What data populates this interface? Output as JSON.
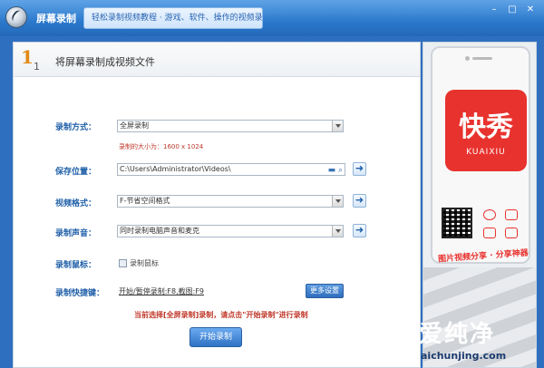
{
  "titlebar": {
    "app_title": "屏幕录制",
    "active_tab": "轻松录制视频教程 · 游戏、软件、操作的视频录制工具",
    "min_glyph": "–",
    "max_glyph": "□",
    "close_glyph": "✕"
  },
  "step": {
    "number": "1",
    "sub": "1",
    "title": "将屏幕录制成视频文件"
  },
  "form": {
    "record_mode_label": "录制方式：",
    "record_mode_value": "全屏录制",
    "record_size_hint": "录制的大小为：1600 x 1024",
    "save_location_label": "保存位置：",
    "save_location_value": "C:\\Users\\Administrator\\Videos\\",
    "video_format_label": "视频格式：",
    "video_format_value": "F-节省空间格式",
    "record_audio_label": "录制声音：",
    "record_audio_value": "同时录制电脑声音和麦克",
    "record_cursor_label": "录制鼠标：",
    "record_cursor_checkbox": "录制鼠标",
    "hotkey_label": "录制快捷键：",
    "hotkey_value": "开始/暂停录制:F8,截图:F9",
    "more_settings": "更多设置",
    "go_glyph": "➜"
  },
  "notice": "当前选择[全屏录制]录制，请点击\"开始录制\"进行录制",
  "start_button": "开始录制",
  "ad": {
    "brand": "快秀",
    "brand_en": "KUAIXIU",
    "slogan": "图片视频分享 · 分享神器"
  },
  "watermark": {
    "text": "爱纯净",
    "url": "aichunjing.com"
  }
}
